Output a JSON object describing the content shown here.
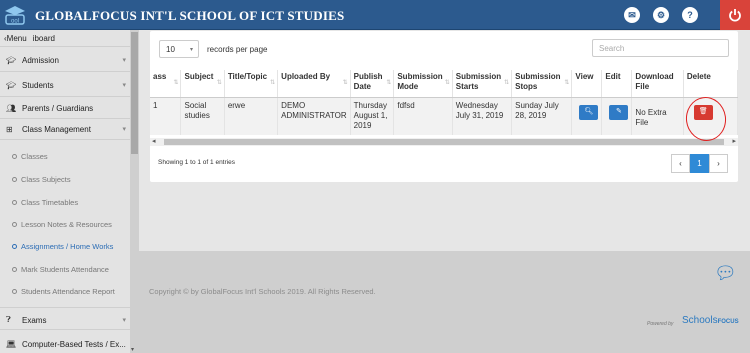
{
  "app": {
    "title": "GLOBALFOCUS INT'L SCHOOL OF ICT STUDIES",
    "logo_text": "ool"
  },
  "topbar": {
    "icons": [
      "mail-icon",
      "settings-icon",
      "help-icon",
      "power-icon"
    ],
    "help_glyph": "?"
  },
  "sidebar": {
    "menu_label": "Menu",
    "menu_hidden_text": "iboard",
    "items": [
      {
        "label": "Admission",
        "icon": "graduation-cap-icon"
      },
      {
        "label": "Students",
        "icon": "graduation-cap-icon"
      },
      {
        "label": "Parents / Guardians",
        "icon": "users-icon"
      },
      {
        "label": "Class Management",
        "icon": "sitemap-icon"
      }
    ],
    "sub_items": [
      {
        "label": "Classes"
      },
      {
        "label": "Class Subjects"
      },
      {
        "label": "Class Timetables"
      },
      {
        "label": "Lesson Notes & Resources"
      },
      {
        "label": "Assignments / Home Works",
        "active": true
      },
      {
        "label": "Mark Students Attendance"
      },
      {
        "label": "Students Attendance Report"
      }
    ],
    "bottom_items": [
      {
        "label": "Exams",
        "icon": "question-circle-icon"
      },
      {
        "label": "Computer-Based Tests / Ex...",
        "icon": "laptop-icon"
      }
    ]
  },
  "table_controls": {
    "page_length": "10",
    "records_label": "records per page",
    "search_placeholder": "Search"
  },
  "table": {
    "headers": [
      "ass",
      "Subject",
      "Title/Topic",
      "Uploaded By",
      "Publish Date",
      "Submission Mode",
      "Submission Starts",
      "Submission Stops",
      "View",
      "Edit",
      "Download File",
      "Delete"
    ],
    "rows": [
      {
        "class": "1",
        "subject": "Social studies",
        "title": "erwe",
        "uploaded_by": "DEMO ADMINISTRATOR",
        "publish_date": "Thursday August 1, 2019",
        "mode": "fdfsd",
        "starts": "Wednesday July 31, 2019",
        "stops": "Sunday July 28, 2019",
        "download": "No Extra File"
      }
    ]
  },
  "pagination": {
    "info": "Showing 1 to 1 of 1 entries",
    "prev": "‹",
    "current": "1",
    "next": "›"
  },
  "footer": {
    "copyright": "Copyright © by GlobalFocus Int'l Schools 2019. All Rights Reserved.",
    "powered_by": "Powered by",
    "brand_main": "Schools",
    "brand_sub": "FOCUS"
  },
  "colors": {
    "topbar": "#2c5a8e",
    "accent_blue": "#2f7bc6",
    "delete_red": "#d73a31"
  }
}
